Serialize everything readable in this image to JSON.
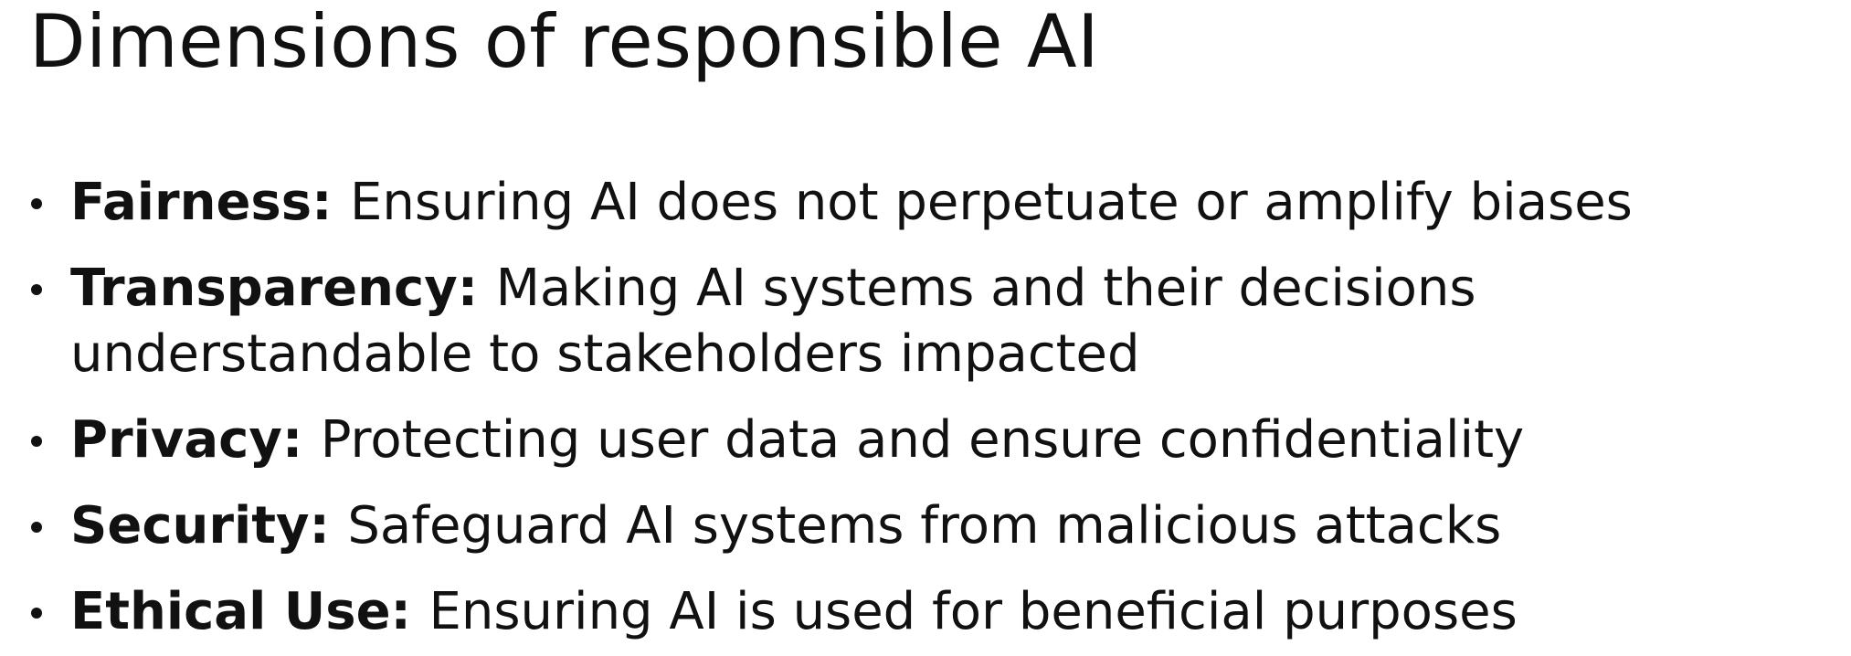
{
  "slide": {
    "title": "Dimensions of responsible AI",
    "bullets": [
      {
        "term": "Fairness:",
        "text": "Ensuring AI does not perpetuate or amplify biases"
      },
      {
        "term": "Transparency:",
        "text": "Making AI systems and their decisions understandable to stakeholders impacted"
      },
      {
        "term": "Privacy:",
        "text": "Protecting user data and ensure confidentiality"
      },
      {
        "term": "Security:",
        "text": "Safeguard AI systems from malicious attacks"
      },
      {
        "term": "Ethical Use:",
        "text": "Ensuring AI is used for beneficial purposes"
      }
    ]
  }
}
